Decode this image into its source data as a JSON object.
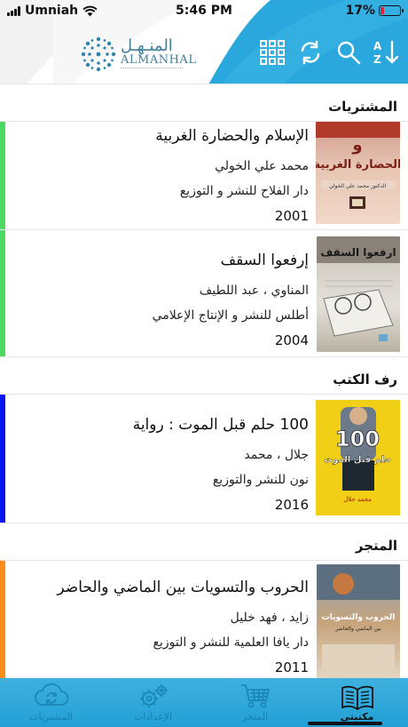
{
  "status": {
    "carrier": "Umniah",
    "time": "5:46 PM",
    "battery": "17%",
    "battery_level": 0.17
  },
  "logo": {
    "arabic": "المنـهـل",
    "english": "ALMANHAL"
  },
  "colors": {
    "brand": "#2aa7dc",
    "purchases": "#4cd964",
    "shelf": "#0a14f0",
    "store": "#ff8c1a"
  },
  "toolbar": {
    "icons": [
      "grid-icon",
      "sync-icon",
      "search-icon",
      "sort-az-icon"
    ]
  },
  "sections": [
    {
      "title": "المشتريات",
      "items": [
        {
          "title": "الإسلام والحضارة الغربية",
          "author": "محمد علي الخولي",
          "publisher": "دار الفلاح للنشر و التوزيع",
          "year": "2001"
        },
        {
          "title": "إرفعوا السقف",
          "author": "المناوي ، عبد اللطيف",
          "publisher": "أطلس للنشر و الإنتاج الإعلامي",
          "year": "2004"
        }
      ]
    },
    {
      "title": "رف الكتب",
      "items": [
        {
          "title": "100 حلم قبل الموت : رواية",
          "author": "جلال ، محمد",
          "publisher": "نون للنشر والتوزيع",
          "year": "2016"
        }
      ]
    },
    {
      "title": "المتجر",
      "items": [
        {
          "title": "الحروب والتسويات بين الماضي والحاضر",
          "author": "زايد ، فهد خليل",
          "publisher": "دار يافا العلمية للنشر و التوزيع",
          "year": "2011"
        }
      ]
    }
  ],
  "covers": {
    "c1": {
      "line1": "و",
      "line2": "الحضارة الغربية",
      "line3": "الدكتور محمد علي الخولي"
    },
    "c2": {
      "line1": "ارفعوا السقف"
    },
    "c3": {
      "line1": "100",
      "line2": "حلم قبل الموت",
      "line3": "محمد جلال"
    },
    "c4": {
      "line1": "الحروب والتسويات",
      "line2": "بين الماضي والحاضر"
    }
  },
  "tabs": [
    {
      "label": "المشتريات",
      "icon": "cloud-sync-icon"
    },
    {
      "label": "الإعدادات",
      "icon": "gears-icon"
    },
    {
      "label": "المتجر",
      "icon": "cart-icon"
    },
    {
      "label": "مكتبتي",
      "icon": "books-icon",
      "active": true
    }
  ]
}
